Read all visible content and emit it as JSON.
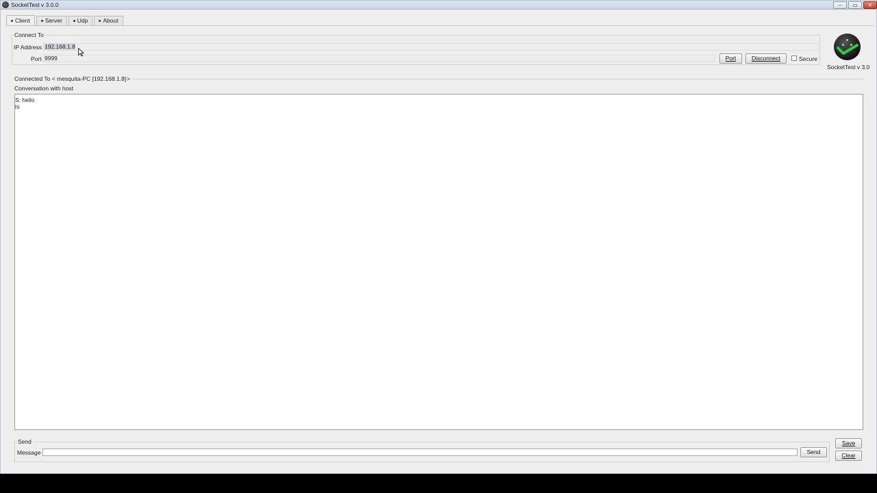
{
  "window": {
    "title": "SocketTest v 3.0.0",
    "minimize_glyph": "–",
    "maximize_glyph": "▭",
    "close_glyph": "✕"
  },
  "tabs": [
    {
      "label": "Client",
      "active": true
    },
    {
      "label": "Server",
      "active": false
    },
    {
      "label": "Udp",
      "active": false
    },
    {
      "label": "About",
      "active": false
    }
  ],
  "connect": {
    "group_title": "Connect To",
    "ip_label": "IP Address",
    "ip_value": "192.168.1.8",
    "port_label": "Port",
    "port_value": "9999",
    "port_button": "Port",
    "disconnect_button": "Disconnect",
    "secure_label": "Secure",
    "secure_checked": false
  },
  "logo": {
    "icon": "socket-plug-checkmark-icon",
    "caption": "SocketTest v 3.0"
  },
  "connected": {
    "label": "Connected To <",
    "host": "mesquita-PC [192.168.1.8]",
    "suffix": ">"
  },
  "conversation": {
    "title": "Conversation with host",
    "lines": [
      "S: hello",
      "hi"
    ]
  },
  "send": {
    "group_title": "Send",
    "message_label": "Message",
    "message_value": "",
    "send_button": "Send",
    "save_button": "Save",
    "clear_button": "Clear"
  },
  "colors": {
    "window_bg": "#eeeeee",
    "logo_check": "#2ecc40"
  }
}
